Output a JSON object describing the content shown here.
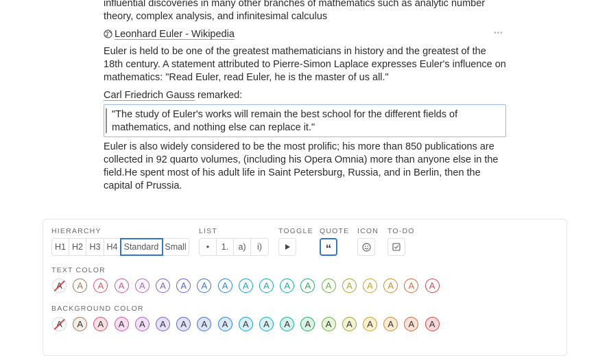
{
  "doc": {
    "para1_tail": "influential discoveries in many other branches of mathematics such as analytic number theory, complex analysis, and infinitesimal calculus",
    "link_text": "Leonhard Euler - Wikipedia",
    "para2": "Euler is held to be one of the greatest mathematicians in history and the greatest of the 18th century. A statement attributed to Pierre-Simon Laplace expresses Euler's influence on mathematics: \"Read Euler, read Euler, he is the master of us all.\"",
    "gauss_link": "Carl Friedrich Gauss",
    "gauss_remark": "remarked:",
    "quote": "\"The study of Euler's works will remain the best school for the different fields of mathematics, and nothing else can replace it.\"",
    "para3": "Euler is also widely considered to be the most prolific; his more than 850 publications are collected in 92 quarto volumes, (including his Opera Omnia) more than anyone else in the field.He spent most of his adult life in Saint Petersburg, Russia, and in Berlin, then the capital of Prussia.",
    "more_icon": "ellipsis-icon"
  },
  "toolbar": {
    "hierarchy_label": "HIERARCHY",
    "hierarchy_options": [
      "H1",
      "H2",
      "H3",
      "H4",
      "Standard",
      "Small"
    ],
    "hierarchy_selected": "Standard",
    "list_label": "LIST",
    "list_options": [
      "•",
      "1.",
      "a)",
      "i)"
    ],
    "toggle_label": "TOGGLE",
    "quote_label": "QUOTE",
    "icon_label": "ICON",
    "todo_label": "TO-DO",
    "text_color_label": "TEXT COLOR",
    "background_color_label": "BACKGROUND COLOR",
    "swatch_letter": "A",
    "text_colors": [
      "#ffffff",
      "#9a7a5a",
      "#d4556a",
      "#d04fa6",
      "#b45ad6",
      "#7d5ad6",
      "#5a61d6",
      "#3d6fd6",
      "#2e82d8",
      "#1c99cf",
      "#1aa6b8",
      "#17a89a",
      "#2aa86a",
      "#67b23a",
      "#a3a62c",
      "#c8a020",
      "#d0892a",
      "#d46a3c",
      "#d04a4a"
    ],
    "bg_colors": [
      "#ffffff",
      "#f3eee8",
      "#fbe1e5",
      "#f8def0",
      "#f1e0f9",
      "#e8e1fb",
      "#e1e3fb",
      "#dde5fb",
      "#dcebfb",
      "#daf1fa",
      "#d9f3f4",
      "#d8f3ed",
      "#dbf3e2",
      "#e8f6d8",
      "#f2f3d3",
      "#faf2cf",
      "#fbebd3",
      "#fbe1d6",
      "#fbdada"
    ]
  }
}
